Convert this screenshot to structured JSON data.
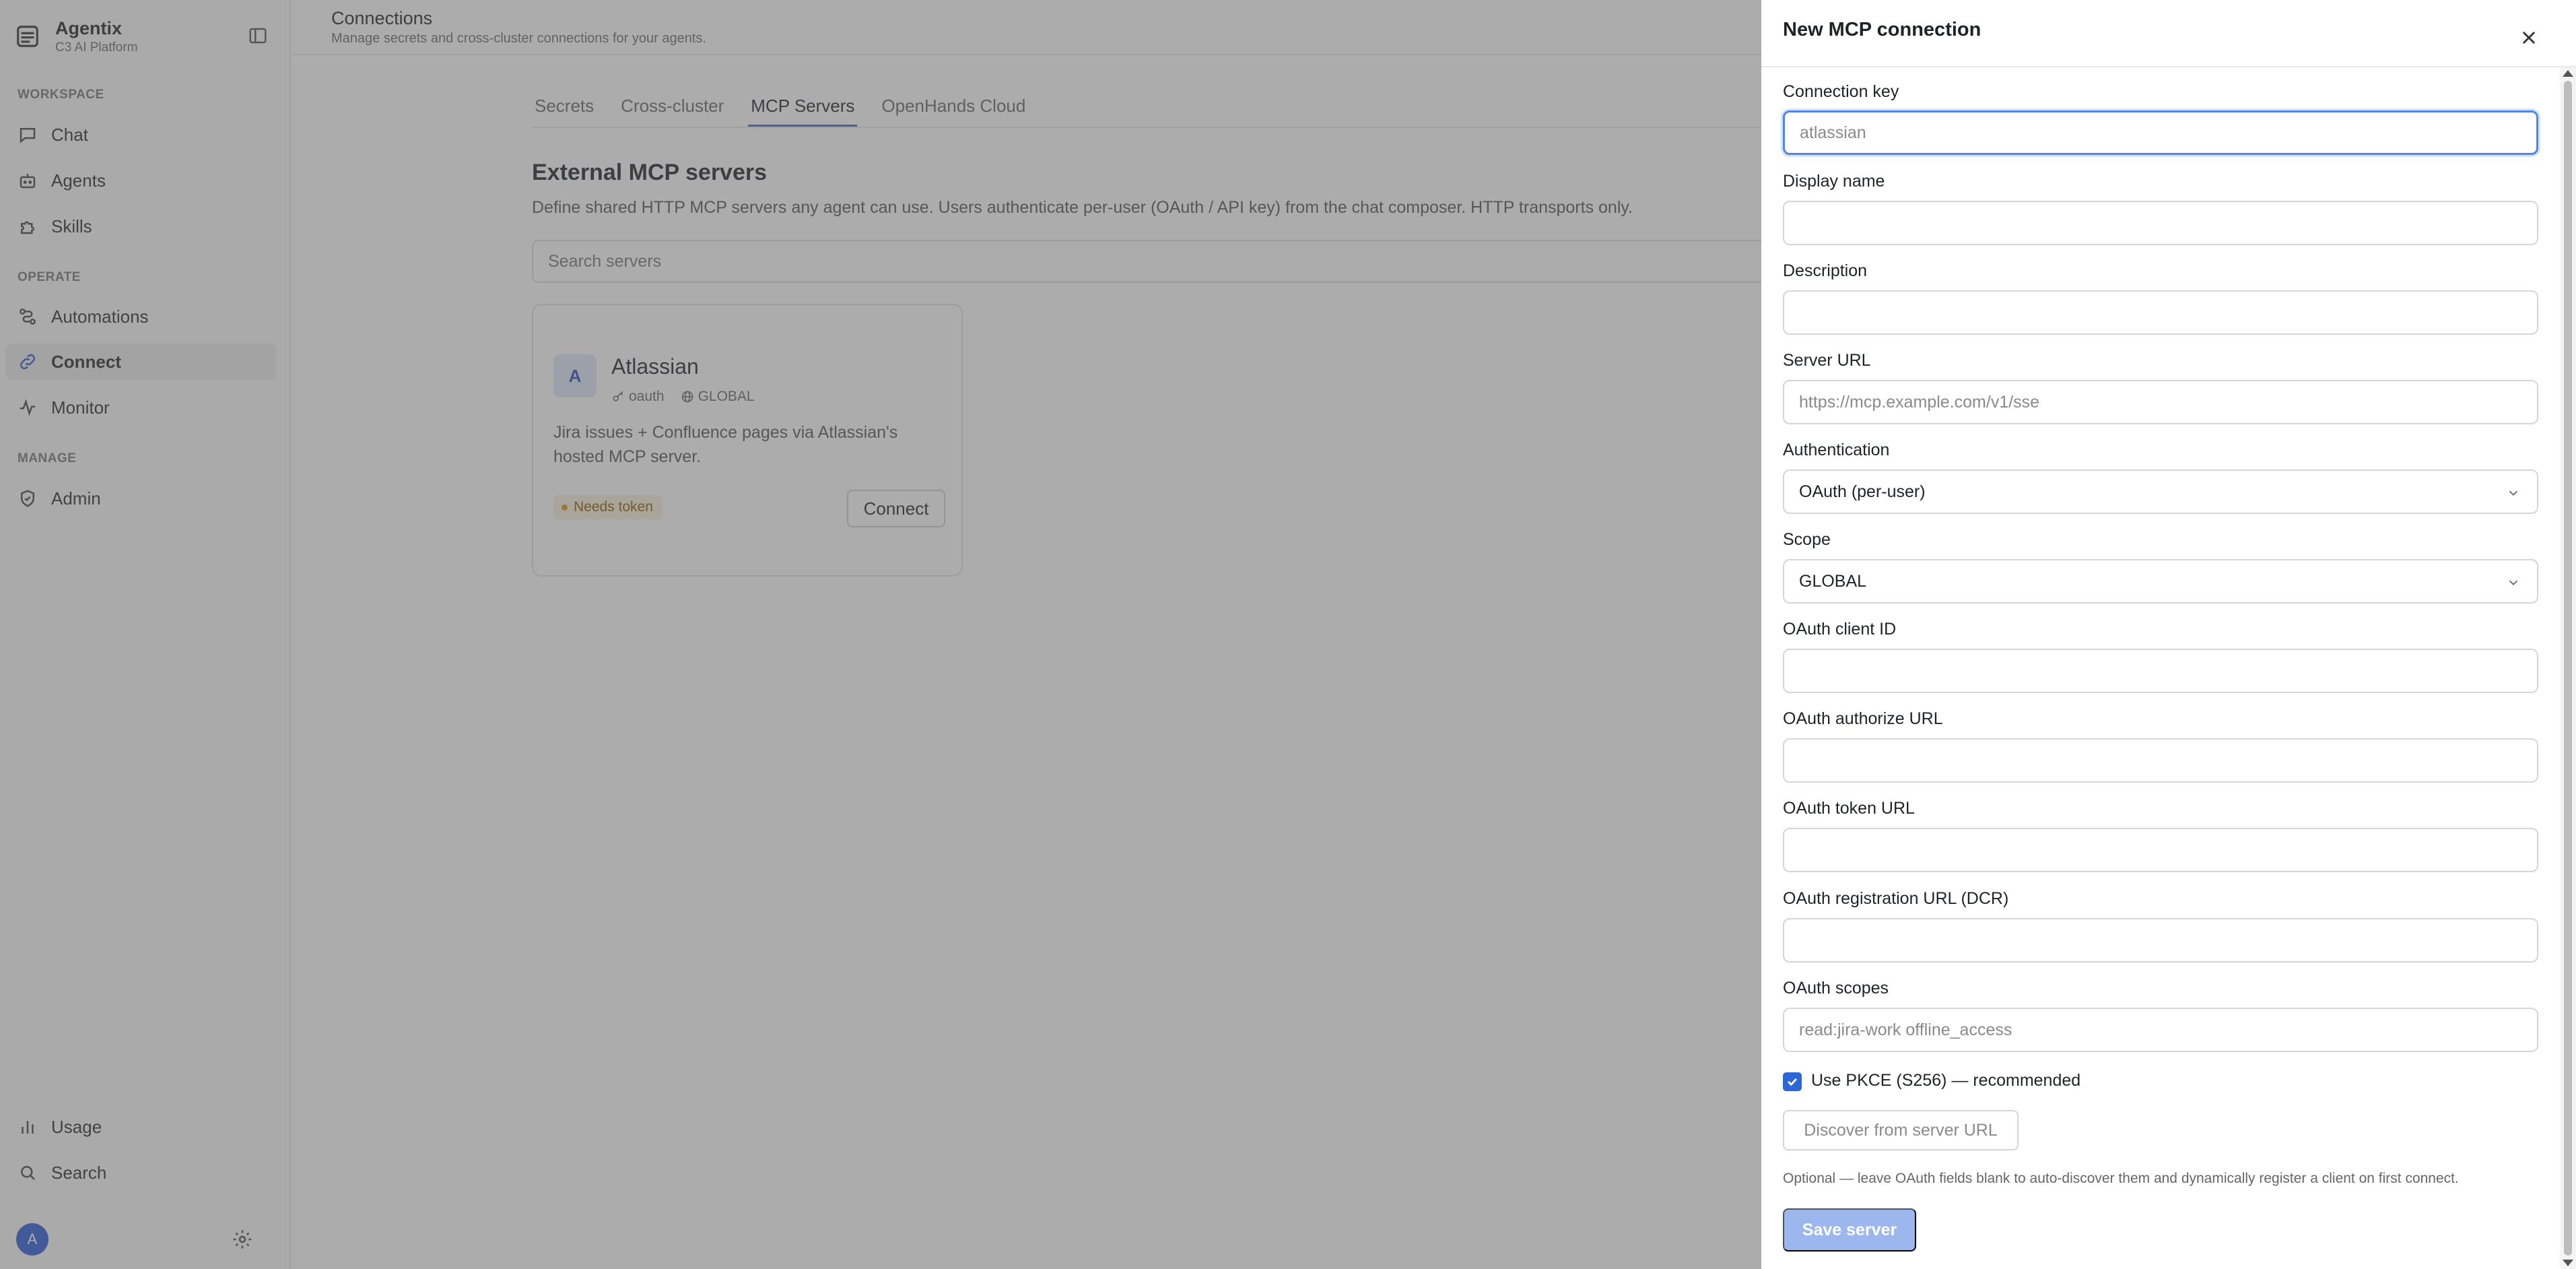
{
  "app": {
    "name": "Agentix",
    "subtitle": "C3 AI Platform"
  },
  "sidebar": {
    "sections": [
      {
        "label": "WORKSPACE",
        "items": [
          {
            "label": "Chat",
            "icon": "chat-icon"
          },
          {
            "label": "Agents",
            "icon": "robot-icon"
          },
          {
            "label": "Skills",
            "icon": "puzzle-icon"
          }
        ]
      },
      {
        "label": "OPERATE",
        "items": [
          {
            "label": "Automations",
            "icon": "workflow-icon"
          },
          {
            "label": "Connect",
            "icon": "link-icon",
            "active": true
          },
          {
            "label": "Monitor",
            "icon": "activity-icon"
          }
        ]
      },
      {
        "label": "MANAGE",
        "items": [
          {
            "label": "Admin",
            "icon": "shield-icon"
          }
        ]
      }
    ],
    "bottom": [
      {
        "label": "Usage",
        "icon": "bar-chart-icon"
      },
      {
        "label": "Search",
        "icon": "search-icon"
      }
    ],
    "user_initial": "A"
  },
  "header": {
    "title": "Connections",
    "subtitle": "Manage secrets and cross-cluster connections for your agents."
  },
  "tabs": [
    {
      "label": "Secrets"
    },
    {
      "label": "Cross-cluster"
    },
    {
      "label": "MCP Servers",
      "active": true
    },
    {
      "label": "OpenHands Cloud"
    }
  ],
  "content": {
    "heading": "External MCP servers",
    "description": "Define shared HTTP MCP servers any agent can use. Users authenticate per-user (OAuth / API key) from the chat composer. HTTP transports only.",
    "search_placeholder": "Search servers"
  },
  "servers": [
    {
      "initial": "A",
      "name": "Atlassian",
      "auth": "oauth",
      "scope": "GLOBAL",
      "description": "Jira issues + Confluence pages via Atlassian's hosted MCP server.",
      "status": "Needs token",
      "action": "Connect"
    }
  ],
  "drawer": {
    "title": "New MCP connection",
    "fields": {
      "key": {
        "label": "Connection key",
        "value": "",
        "placeholder": "atlassian"
      },
      "display_name": {
        "label": "Display name",
        "value": "",
        "placeholder": ""
      },
      "description": {
        "label": "Description",
        "value": "",
        "placeholder": ""
      },
      "server_url": {
        "label": "Server URL",
        "value": "",
        "placeholder": "https://mcp.example.com/v1/sse"
      },
      "authentication": {
        "label": "Authentication",
        "value": "OAuth (per-user)"
      },
      "scope": {
        "label": "Scope",
        "value": "GLOBAL"
      },
      "client_id": {
        "label": "OAuth client ID",
        "value": "",
        "placeholder": ""
      },
      "authorize_url": {
        "label": "OAuth authorize URL",
        "value": "",
        "placeholder": ""
      },
      "token_url": {
        "label": "OAuth token URL",
        "value": "",
        "placeholder": ""
      },
      "registration_url": {
        "label": "OAuth registration URL (DCR)",
        "value": "",
        "placeholder": ""
      },
      "scopes": {
        "label": "OAuth scopes",
        "value": "",
        "placeholder": "read:jira-work offline_access"
      }
    },
    "pkce": {
      "label": "Use PKCE (S256) — recommended",
      "checked": true
    },
    "discover_label": "Discover from server URL",
    "hint": "Optional — leave OAuth fields blank to auto-discover them and dynamically register a client on first connect.",
    "save_label": "Save server"
  },
  "colors": {
    "accent": "#3a66d9",
    "save_disabled": "#9bb7ee",
    "badge_bg": "#fbf1dc",
    "badge_text": "#8a5a00",
    "avatar": "#2a5bd7"
  }
}
